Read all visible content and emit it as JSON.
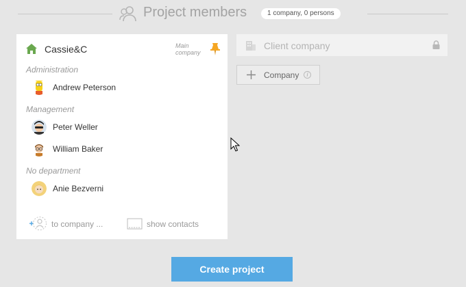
{
  "header": {
    "title": "Project members",
    "badge": "1 company, 0 persons"
  },
  "main_company": {
    "name": "Cassie&C",
    "main_label": "Main company",
    "departments": [
      {
        "name": "Administration",
        "members": [
          {
            "name": "Andrew Peterson",
            "avatar": "bart-avatar-icon"
          }
        ]
      },
      {
        "name": "Management",
        "members": [
          {
            "name": "Peter Weller",
            "avatar": "sunglasses-avatar-icon"
          },
          {
            "name": "William Baker",
            "avatar": "glasses-avatar-icon"
          }
        ]
      },
      {
        "name": "No department",
        "members": [
          {
            "name": "Anie Bezverni",
            "avatar": "blonde-avatar-icon"
          }
        ]
      }
    ],
    "footer": {
      "add_to_company": "to company ...",
      "show_contacts": "show contacts"
    }
  },
  "client": {
    "label": "Client company"
  },
  "add_company": {
    "label": "Company",
    "info": "i"
  },
  "actions": {
    "create": "Create project"
  },
  "colors": {
    "accent": "#55a9e3",
    "home": "#6aa84f",
    "pin": "#f5a623",
    "background": "#e6e6e6"
  }
}
